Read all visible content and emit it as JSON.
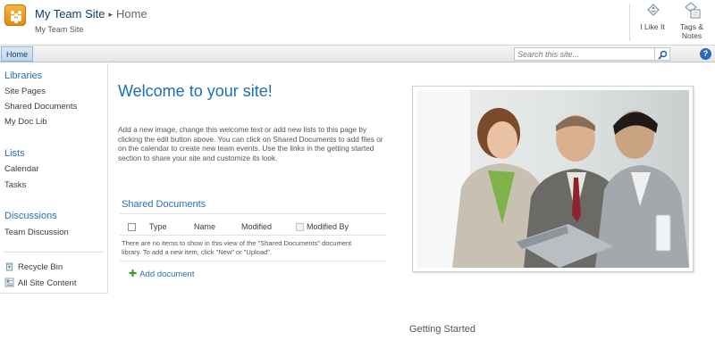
{
  "header": {
    "site_name": "My Team Site",
    "breadcrumb_separator": "▸",
    "page_name": "Home",
    "subtitle": "My Team Site"
  },
  "ribbon": {
    "like_label": "I Like It",
    "tags_label_line1": "Tags &",
    "tags_label_line2": "Notes"
  },
  "topnav": {
    "home_tab": "Home",
    "search_placeholder": "Search this site...",
    "help_glyph": "?"
  },
  "quick_launch": {
    "libraries": {
      "heading": "Libraries",
      "items": [
        "Site Pages",
        "Shared Documents",
        "My Doc Lib"
      ]
    },
    "lists": {
      "heading": "Lists",
      "items": [
        "Calendar",
        "Tasks"
      ]
    },
    "discussions": {
      "heading": "Discussions",
      "items": [
        "Team Discussion"
      ]
    },
    "footer": {
      "recycle_bin": "Recycle Bin",
      "all_site_content": "All Site Content"
    }
  },
  "main": {
    "welcome_heading": "Welcome to your site!",
    "intro_text": "Add a new image, change this welcome text or add new lists to this page by clicking the edit button above. You can click on Shared Documents to add files or on the calendar to create new team events. Use the links in the getting started section to share your site and customize its look.",
    "shared_documents": {
      "title": "Shared Documents",
      "columns": [
        "Type",
        "Name",
        "Modified",
        "Modified By"
      ],
      "empty_message": "There are no items to show in this view of the \"Shared Documents\" document library. To add a new item, click \"New\" or \"Upload\".",
      "add_document": "Add document"
    },
    "getting_started": "Getting Started"
  },
  "colors": {
    "link_blue": "#1a6fb4",
    "logo_orange": "#f0a023",
    "add_green": "#3d9a2b"
  }
}
